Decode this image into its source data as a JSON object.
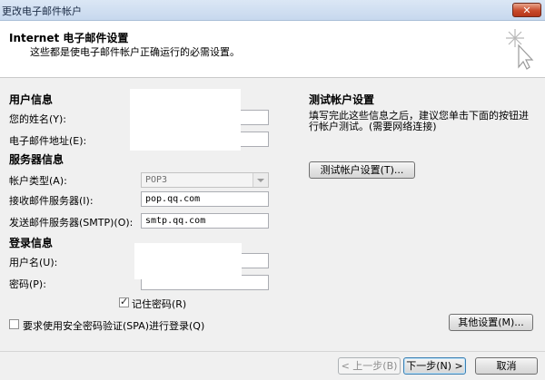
{
  "window": {
    "title": "更改电子邮件帐户",
    "close_glyph": "✕"
  },
  "header": {
    "title": "Internet 电子邮件设置",
    "subtitle": "这些都是使电子邮件帐户正确运行的必需设置。",
    "icon": "cursor-sparkle-icon"
  },
  "user_info": {
    "heading": "用户信息",
    "name_label": "您的姓名(Y):",
    "name_value": "",
    "email_label": "电子邮件地址(E):",
    "email_value": ""
  },
  "server_info": {
    "heading": "服务器信息",
    "account_type_label": "帐户类型(A):",
    "account_type_value": "POP3",
    "incoming_label": "接收邮件服务器(I):",
    "incoming_value": "pop.qq.com",
    "outgoing_label": "发送邮件服务器(SMTP)(O):",
    "outgoing_value": "smtp.qq.com"
  },
  "logon_info": {
    "heading": "登录信息",
    "username_label": "用户名(U):",
    "username_value": "",
    "password_label": "密码(P):",
    "password_value": "",
    "remember_label": "记住密码(R)",
    "remember_checked": true,
    "spa_label": "要求使用安全密码验证(SPA)进行登录(Q)",
    "spa_checked": false
  },
  "test_settings": {
    "heading": "测试帐户设置",
    "description": "填写完此这些信息之后，建议您单击下面的按钮进行帐户测试。(需要网络连接)",
    "test_button": "测试帐户设置(T)..."
  },
  "buttons": {
    "more_settings": "其他设置(M)...",
    "back": "< 上一步(B)",
    "next": "下一步(N) >",
    "cancel": "取消"
  }
}
